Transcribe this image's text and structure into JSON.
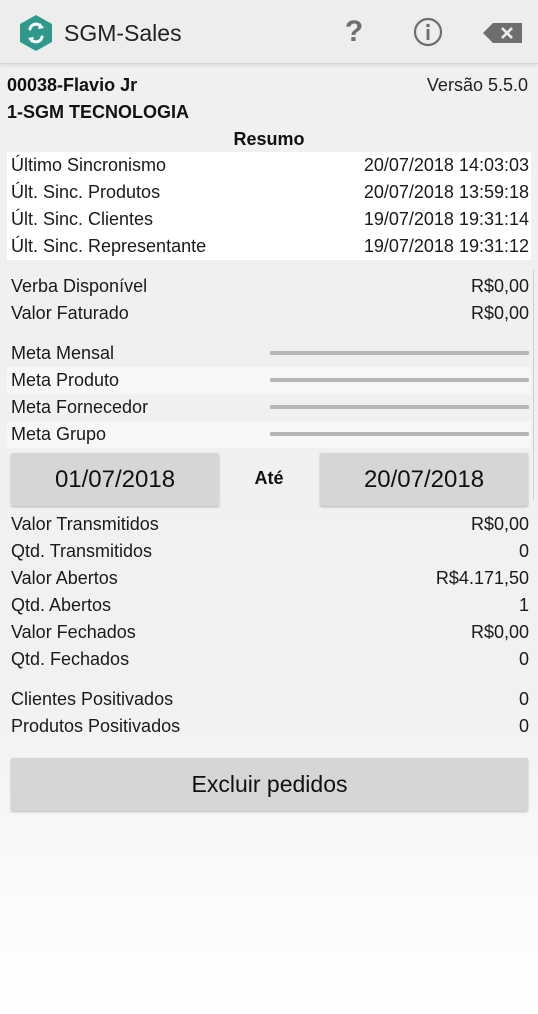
{
  "appbar": {
    "title": "SGM-Sales",
    "logo_icon": "app-logo-icon",
    "help_label": "?",
    "help_icon": "help-icon",
    "info_icon": "info-icon",
    "delete_icon": "backspace-icon"
  },
  "header": {
    "user": "00038-Flavio Jr",
    "version": "Versão 5.5.0",
    "company": "1-SGM TECNOLOGIA"
  },
  "resumo_title": "Resumo",
  "sync": [
    {
      "label": "Último Sincronismo",
      "value": "20/07/2018 14:03:03"
    },
    {
      "label": "Últ. Sinc. Produtos",
      "value": "20/07/2018 13:59:18"
    },
    {
      "label": "Últ. Sinc. Clientes",
      "value": "19/07/2018 19:31:14"
    },
    {
      "label": "Últ. Sinc. Representante",
      "value": "19/07/2018 19:31:12"
    }
  ],
  "finance": [
    {
      "label": "Verba Disponível",
      "value": "R$0,00"
    },
    {
      "label": "Valor Faturado",
      "value": "R$0,00"
    }
  ],
  "metas": [
    {
      "label": "Meta Mensal",
      "progress": 0
    },
    {
      "label": "Meta Produto",
      "progress": 0
    },
    {
      "label": "Meta Fornecedor",
      "progress": 0
    },
    {
      "label": "Meta Grupo",
      "progress": 0
    }
  ],
  "period": {
    "start": "01/07/2018",
    "separator": "Até",
    "end": "20/07/2018"
  },
  "orders": [
    {
      "label": "Valor Transmitidos",
      "value": "R$0,00"
    },
    {
      "label": "Qtd. Transmitidos",
      "value": "0"
    },
    {
      "label": "Valor Abertos",
      "value": "R$4.171,50"
    },
    {
      "label": "Qtd. Abertos",
      "value": "1"
    },
    {
      "label": "Valor Fechados",
      "value": "R$0,00"
    },
    {
      "label": "Qtd. Fechados",
      "value": "0"
    }
  ],
  "positivados": [
    {
      "label": "Clientes Positivados",
      "value": "0"
    },
    {
      "label": "Produtos Positivados",
      "value": "0"
    }
  ],
  "excluir_label": "Excluir pedidos",
  "colors": {
    "logo": "#2f9a8c",
    "button_bg": "#d6d6d6",
    "progress_track": "#b6b6b6"
  }
}
